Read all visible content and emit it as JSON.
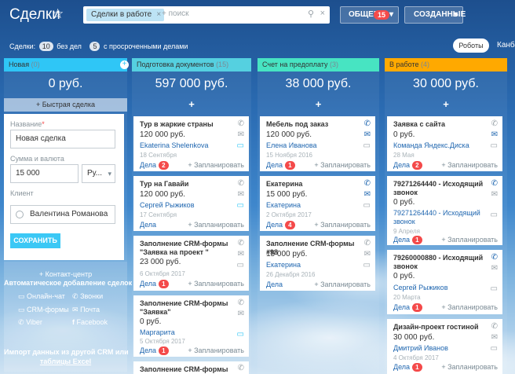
{
  "header": {
    "title": "Сделки",
    "filter_chip": "Сделки в работе",
    "search_placeholder": "+ поиск",
    "btn_general": "ОБЩЕЕ",
    "btn_general_count": "15",
    "btn_created": "СОЗДАННЫЕ",
    "chevron": "▾"
  },
  "stats": {
    "label": "Сделки:",
    "no_deals_count": "10",
    "no_deals_label": "без дел",
    "overdue_count": "5",
    "overdue_label": "с просроченными делами",
    "robots": "Роботы",
    "kanban": "Канбан"
  },
  "columns": [
    {
      "name": "Новая",
      "count": "(0)",
      "sum": "0 руб.",
      "color": "#2fc6f6"
    },
    {
      "name": "Подготовка документов",
      "count": "(15)",
      "sum": "597 000 руб.",
      "color": "#55d0e0"
    },
    {
      "name": "Счет на предоплату",
      "count": "(3)",
      "sum": "38 000 руб.",
      "color": "#47e4c2"
    },
    {
      "name": "В работе",
      "count": "(4)",
      "sum": "30 000 руб.",
      "color": "#ffa900"
    }
  ],
  "quick_form": {
    "quick_button": "+ Быстрая сделка",
    "name_label": "Название",
    "name_required": "*",
    "name_value": "Новая сделка",
    "sum_label": "Сумма и валюта",
    "sum_value": "15 000",
    "currency_value": "Ру...",
    "client_label": "Клиент",
    "client_value": "Валентина Романова",
    "save": "СОХРАНИТЬ"
  },
  "integrations": {
    "contact_center": "+ Контакт-центр",
    "auto_add": "Автоматическое добавление сделок",
    "items": [
      "Онлайн-чат",
      "Звонки",
      "CRM-формы",
      "Почта",
      "Viber",
      "Facebook"
    ],
    "import_line1": "Импорт данных из другой CRM или",
    "import_line2": "таблицы Excel"
  },
  "cards_col2": [
    {
      "title": "Тур в жаркие страны",
      "sum": "120 000 руб.",
      "client": "Ekaterina Shelenkova",
      "date": "18 Сентября",
      "acts": "Дела",
      "badge": "2",
      "plan": "+ Запланировать"
    },
    {
      "title": "Тур на Гавайи",
      "sum": "120 000 руб.",
      "client": "Сергей Рыжиков",
      "date": "17 Сентября",
      "acts": "Дела",
      "badge": "",
      "plan": "+ Запланировать"
    },
    {
      "title": "Заполнение CRM-формы \"Заявка на проект \"",
      "sum": "23 000 руб.",
      "client": "",
      "date": "6 Октября 2017",
      "acts": "Дела",
      "badge": "1",
      "plan": "+ Запланировать"
    },
    {
      "title": "Заполнение CRM-формы \"Заявка\"",
      "sum": "0 руб.",
      "client": "Маргарита",
      "date": "5 Октября 2017",
      "acts": "Дела",
      "badge": "1",
      "plan": "+ Запланировать"
    },
    {
      "title": "Заполнение CRM-формы",
      "sum": "",
      "client": "",
      "date": "",
      "acts": "",
      "badge": "",
      "plan": ""
    }
  ],
  "cards_col3": [
    {
      "title": "Мебель под заказ",
      "sum": "120 000 руб.",
      "client": "Елена Иванова",
      "date": "15 Ноября 2016",
      "acts": "Дела",
      "badge": "1",
      "plan": "+ Запланировать"
    },
    {
      "title": "Екатерина",
      "sum": "15 000 руб.",
      "client": "Екатерина",
      "date": "2 Октября 2017",
      "acts": "Дела",
      "badge": "4",
      "plan": "+ Запланировать"
    },
    {
      "title": "Заполнение CRM-формы #98",
      "sum": "15 000 руб.",
      "client": "Екатерина",
      "date": "26 Декабря 2016",
      "acts": "Дела",
      "badge": "",
      "plan": "+ Запланировать"
    }
  ],
  "cards_col4": [
    {
      "title": "Заявка с сайта",
      "sum": "0 руб.",
      "client": "Команда Яндекс.Диска",
      "date": "28 Мая",
      "acts": "Дела",
      "badge": "2",
      "plan": "+ Запланировать"
    },
    {
      "title": "79271264440 - Исходящий звонок",
      "sum": "0 руб.",
      "client": "79271264440 - Исходящий звонок",
      "date": "9 Апреля",
      "acts": "Дела",
      "badge": "1",
      "plan": "+ Запланировать"
    },
    {
      "title": "79260000880 - Исходящий звонок",
      "sum": "0 руб.",
      "client": "Сергей Рыжиков",
      "date": "20 Марта",
      "acts": "Дела",
      "badge": "1",
      "plan": "+ Запланировать"
    },
    {
      "title": "Дизайн-проект гостиной",
      "sum": "30 000 руб.",
      "client": "Дмитрий Иванов",
      "date": "4 Октября 2017",
      "acts": "Дела",
      "badge": "1",
      "plan": "+ Запланировать"
    }
  ],
  "icons": {
    "star": "☆",
    "close": "×",
    "search": "⚲",
    "phone": "✆",
    "mail": "✉",
    "chat": "▭",
    "plus": "+"
  }
}
